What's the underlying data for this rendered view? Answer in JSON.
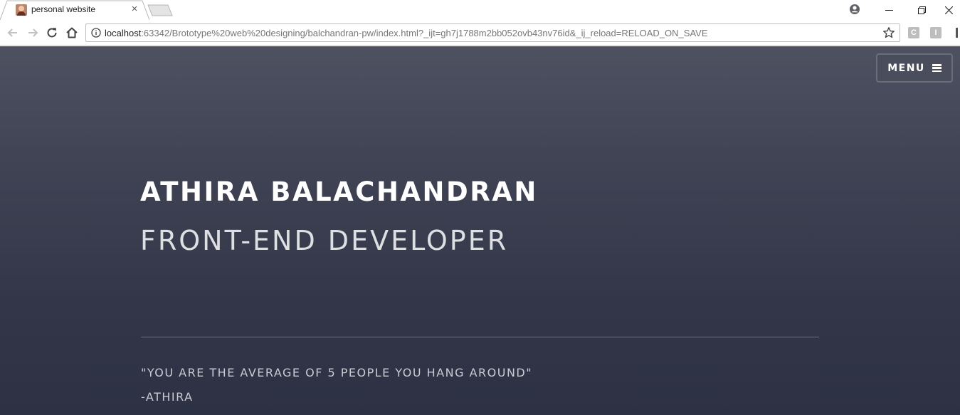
{
  "browser": {
    "tab_title": "personal website",
    "tab_close_glyph": "×",
    "url_host": "localhost",
    "url_rest": ":63342/Brototype%20web%20designing/balchandran-pw/index.html?_ijt=gh7j1788m2bb052ovb43nv76id&_ij_reload=RELOAD_ON_SAVE",
    "extensions": [
      {
        "label": "C",
        "icon": "extension-c-icon"
      },
      {
        "label": "I",
        "icon": "extension-i-icon"
      }
    ],
    "window_controls": {
      "minimize_glyph": "—",
      "restore_glyph": "❐",
      "close_glyph": "✕"
    }
  },
  "page": {
    "menu_label": "MENU",
    "name": "ATHIRA BALACHANDRAN",
    "role": "FRONT-END DEVELOPER",
    "quote": "\"YOU ARE THE AVERAGE OF 5 PEOPLE YOU HANG AROUND\"",
    "quote_author": "-ATHIRA"
  },
  "colors": {
    "hero_top": "#4d5160",
    "hero_bottom": "#2d3144",
    "text_primary": "#ffffff",
    "text_muted": "#c9cbd3"
  }
}
